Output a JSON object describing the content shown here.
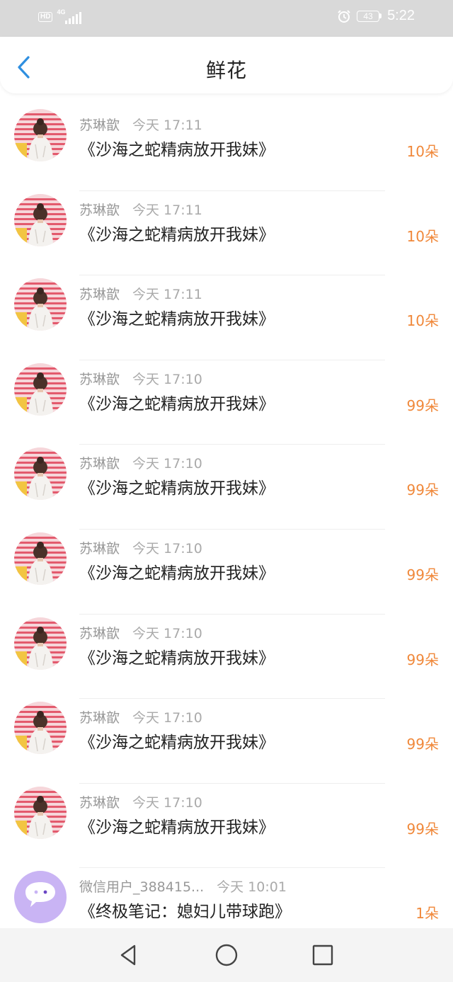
{
  "status_bar": {
    "hd": "HD",
    "network": "4G",
    "battery": "43",
    "time": "5:22"
  },
  "header": {
    "back_icon": "chevron-left-icon",
    "title": "鲜花"
  },
  "items": [
    {
      "sender": "苏琳歆",
      "time": "今天 17:11",
      "title": "《沙海之蛇精病放开我妹》",
      "amount": "10朵",
      "avatar": "photo"
    },
    {
      "sender": "苏琳歆",
      "time": "今天 17:11",
      "title": "《沙海之蛇精病放开我妹》",
      "amount": "10朵",
      "avatar": "photo"
    },
    {
      "sender": "苏琳歆",
      "time": "今天 17:11",
      "title": "《沙海之蛇精病放开我妹》",
      "amount": "10朵",
      "avatar": "photo"
    },
    {
      "sender": "苏琳歆",
      "time": "今天 17:10",
      "title": "《沙海之蛇精病放开我妹》",
      "amount": "99朵",
      "avatar": "photo"
    },
    {
      "sender": "苏琳歆",
      "time": "今天 17:10",
      "title": "《沙海之蛇精病放开我妹》",
      "amount": "99朵",
      "avatar": "photo"
    },
    {
      "sender": "苏琳歆",
      "time": "今天 17:10",
      "title": "《沙海之蛇精病放开我妹》",
      "amount": "99朵",
      "avatar": "photo"
    },
    {
      "sender": "苏琳歆",
      "time": "今天 17:10",
      "title": "《沙海之蛇精病放开我妹》",
      "amount": "99朵",
      "avatar": "photo"
    },
    {
      "sender": "苏琳歆",
      "time": "今天 17:10",
      "title": "《沙海之蛇精病放开我妹》",
      "amount": "99朵",
      "avatar": "photo"
    },
    {
      "sender": "苏琳歆",
      "time": "今天 17:10",
      "title": "《沙海之蛇精病放开我妹》",
      "amount": "99朵",
      "avatar": "photo"
    },
    {
      "sender": "微信用户_388415...",
      "time": "今天 10:01",
      "title": "《终极笔记：媳妇儿带球跑》",
      "amount": "1朵",
      "avatar": "wechat"
    }
  ],
  "colors": {
    "accent_blue": "#2f8fe0",
    "amount_orange": "#f0883a",
    "status_bar_bg": "#d9d9d9"
  },
  "nav": {
    "back": "triangle-back-icon",
    "home": "circle-home-icon",
    "recents": "square-recents-icon"
  }
}
